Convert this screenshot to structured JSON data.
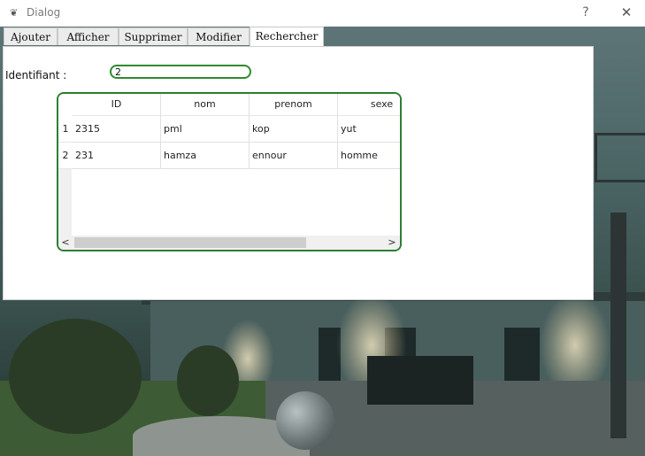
{
  "window": {
    "title": "Dialog",
    "app_icon": "feather-icon",
    "help_label": "?",
    "close_label": "✕"
  },
  "tabs": [
    {
      "label": "Ajouter",
      "active": false
    },
    {
      "label": "Afficher",
      "active": false
    },
    {
      "label": "Supprimer",
      "active": false
    },
    {
      "label": "Modifier",
      "active": false
    },
    {
      "label": "Rechercher",
      "active": true
    }
  ],
  "search": {
    "label": "Identifiant :",
    "value": "2"
  },
  "table": {
    "columns": [
      "ID",
      "nom",
      "prenom",
      "sexe"
    ],
    "rows": [
      {
        "header": "1",
        "cells": [
          "2315",
          "pml",
          "kop",
          "yut"
        ]
      },
      {
        "header": "2",
        "cells": [
          "231",
          "hamza",
          "ennour",
          "homme"
        ]
      }
    ],
    "scroll_left": "<",
    "scroll_right": ">"
  },
  "colors": {
    "accent_border": "#2e7d32",
    "input_border": "#2e8b2e"
  }
}
